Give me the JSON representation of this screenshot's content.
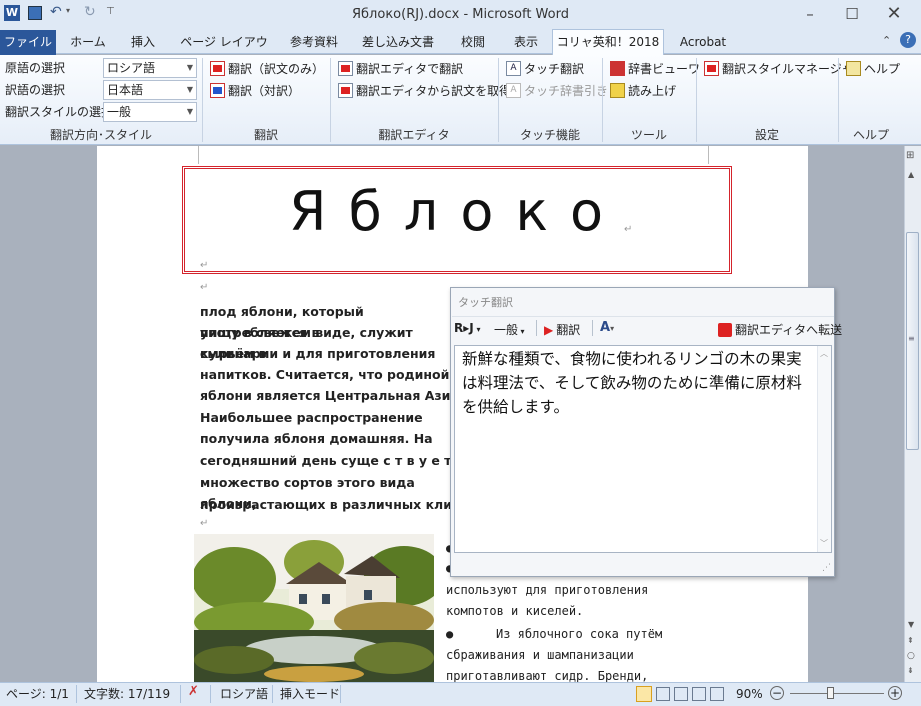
{
  "window": {
    "title": "Яблоко(RJ).docx - Microsoft Word",
    "app_icon": "word-icon",
    "controls": [
      "minimize-icon",
      "maximize-icon",
      "close-icon"
    ]
  },
  "tabs": {
    "file": "ファイル",
    "items": [
      "ホーム",
      "挿入",
      "ページ レイアウト",
      "参考資料",
      "差し込み文書",
      "校閲",
      "表示"
    ],
    "active": "コリャ英和！2018",
    "acrobat": "Acrobat"
  },
  "ribbon": {
    "direction": {
      "source_label": "原語の選択",
      "target_label": "訳語の選択",
      "style_label": "翻訳スタイルの選択",
      "source_value": "ロシア語",
      "target_value": "日本語",
      "style_value": "一般",
      "group": "翻訳方向･スタイル"
    },
    "translate": {
      "only": "翻訳（訳文のみ）",
      "pair": "翻訳（対訳）",
      "group": "翻訳"
    },
    "editor": {
      "translate": "翻訳エディタで翻訳",
      "fetch": "翻訳エディタから訳文を取得",
      "group": "翻訳エディタ"
    },
    "touch": {
      "translate": "タッチ翻訳",
      "dict": "タッチ辞書引き",
      "group": "タッチ機能"
    },
    "tools": {
      "viewer": "辞書ビューワ",
      "read": "読み上げ",
      "group": "ツール"
    },
    "settings": {
      "style_manager": "翻訳スタイルマネージャ",
      "group": "設定"
    },
    "help": {
      "help": "ヘルプ",
      "group": "ヘルプ"
    }
  },
  "document": {
    "heading": "Яблоко",
    "paragraph_lines": [
      "плод яблони, который употребляется в",
      "пищу в свежем виде, служит сырьём в",
      "кулинарии и для приготовления",
      "напитков. Считается, что родиной",
      "яблони является Центральная Азия.",
      "Наибольшее распространение",
      "получила яблоня домашняя. На",
      "сегодняшний день суще с т в у е т",
      "множество сортов этого вида яблони,",
      "произрастающих в различных климатических"
    ],
    "bullet_lines": [
      "используют для приготовления",
      "компотов и киселей.",
      "Из яблочного сока путём",
      "сбраживания и шампанизации",
      "приготавливают сидр. Бренди,"
    ]
  },
  "touch_popup": {
    "title": "タッチ翻訳",
    "mode": "R▸J",
    "style": "一般",
    "translate_btn": "翻訳",
    "transfer_btn": "翻訳エディタへ転送",
    "result": "新鮮な種類で、食物に使われるリンゴの木の果実は料理法で、そして飲み物のために準備に原材料を供給します。"
  },
  "status": {
    "page": "ページ: 1/1",
    "words": "文字数: 17/119",
    "language": "ロシア語",
    "mode": "挿入モード",
    "zoom": "90%"
  },
  "colors": {
    "file_tab": "#2b579a",
    "heading_border": "#d4242c",
    "ribbon_bg": "#e6eef8"
  }
}
